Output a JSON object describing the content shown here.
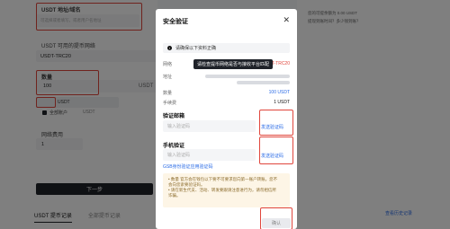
{
  "background": {
    "address_label": "USDT 地址/域名",
    "address_placeholder": "可选择或者填写，或者用户名地址",
    "network_label": "USDT 可用的提币网络",
    "network_value": "USDT-TRC20",
    "amount_label": "数量",
    "amount_value": "100",
    "amount_unit": "USDT",
    "checkbox_label": "全部账户",
    "balance_hint": "USDT",
    "fee_label": "网络费用",
    "fee_value": "1",
    "next_button": "下一步",
    "right_text_1": "您的可提余额为 0.00 USDT",
    "right_text_2": "提现到账时间？多少钱到账？",
    "history_link": "查看历史记录",
    "tabs": [
      "USDT 提币记录",
      "全部提币记录"
    ]
  },
  "modal": {
    "title": "安全验证",
    "notice": "请确保以下资料正确",
    "rows": [
      {
        "label": "网络",
        "value": "USDT-TRC20"
      },
      {
        "label": "地址",
        "value": ""
      },
      {
        "label": "数量",
        "value": "100 USDT"
      },
      {
        "label": "手续费",
        "value": "1 USDT"
      }
    ],
    "tooltip": "请检查提币网络是否与接收平台匹配",
    "email_title": "验证邮箱",
    "email_placeholder": "输入验证码",
    "email_send": "发送验证码",
    "phone_title": "手机验证",
    "phone_placeholder": "输入验证码",
    "phone_send": "发送验证码",
    "link_text": "GSB身份验证应用验证码",
    "warn_lines": [
      "• 数量 官方会在钱包以下要不可要求您向第一账户转账。您不",
      "  会向您索要验证码。",
      "• 请在新生代支、活动、转发要跟请注意进行为，请勿相信所",
      "  诈骗。"
    ],
    "confirm_button": "确认"
  }
}
